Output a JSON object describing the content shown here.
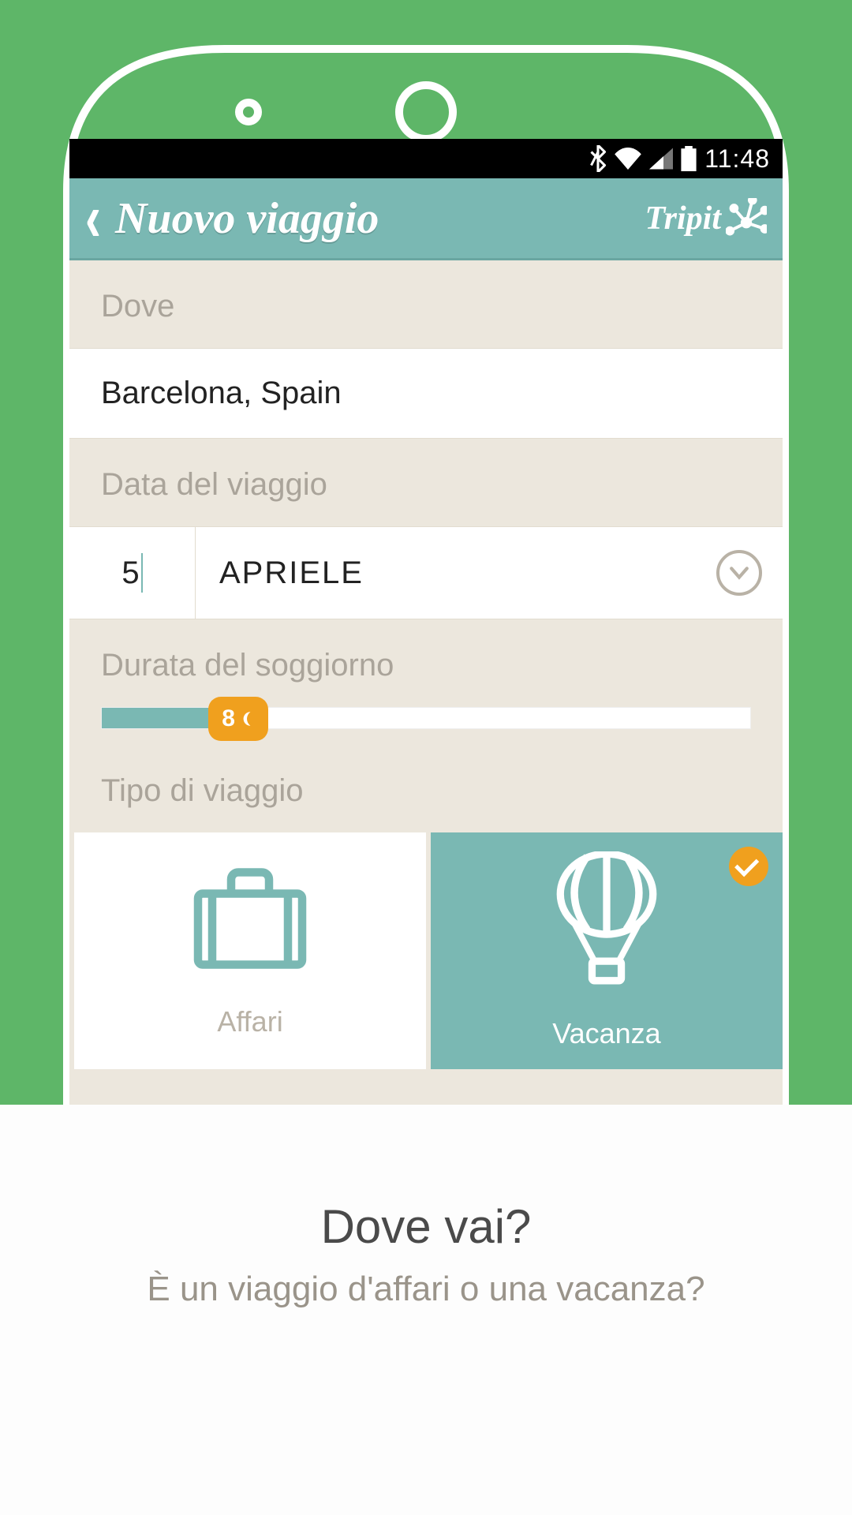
{
  "statusbar": {
    "time": "11:48"
  },
  "header": {
    "title": "Nuovo viaggio",
    "brand": "Tripit"
  },
  "form": {
    "where_label": "Dove",
    "destination": "Barcelona, Spain",
    "date_label": "Data del viaggio",
    "date_day": "5",
    "date_month": "APRIELE",
    "duration_label": "Durata del soggiorno",
    "duration_nights": "8",
    "duration_pct": 21,
    "type_label": "Tipo di viaggio",
    "types": {
      "business": "Affari",
      "leisure": "Vacanza"
    }
  },
  "overlay": {
    "title": "Dove vai?",
    "subtitle": "È un viaggio d'affari o una vacanza?"
  }
}
